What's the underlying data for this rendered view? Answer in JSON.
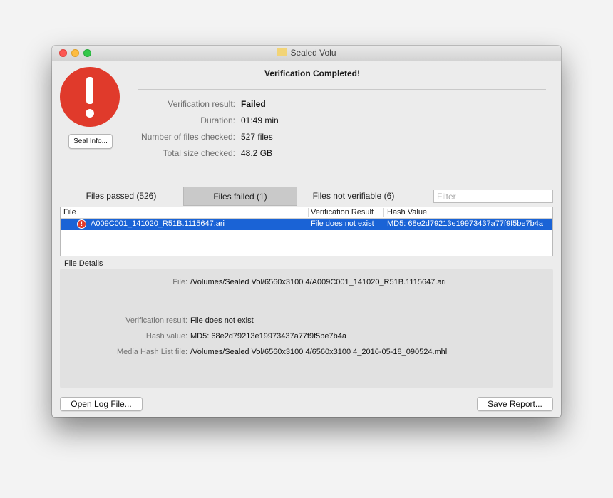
{
  "window": {
    "title": "Sealed Volu"
  },
  "dialog": {
    "heading": "Verification Completed!",
    "seal_info_button": "Seal Info...",
    "summary": [
      {
        "label": "Verification result:",
        "value": "Failed"
      },
      {
        "label": "Duration:",
        "value": "01:49 min"
      },
      {
        "label": "Number of files checked:",
        "value": "527 files"
      },
      {
        "label": "Total size checked:",
        "value": "48.2 GB"
      }
    ]
  },
  "tabs": [
    {
      "label": "Files passed (526)",
      "selected": false
    },
    {
      "label": "Files failed (1)",
      "selected": true
    },
    {
      "label": "Files not verifiable (6)",
      "selected": false
    }
  ],
  "filter": {
    "placeholder": "Filter",
    "value": ""
  },
  "table": {
    "columns": [
      "File",
      "Verification Result",
      "Hash Value"
    ],
    "rows": [
      {
        "file": "A009C001_141020_R51B.1115647.ari",
        "result": "File does not exist",
        "hash": "MD5: 68e2d79213e19973437a77f9f5be7b4a",
        "selected": true,
        "status_icon": "error-icon"
      }
    ]
  },
  "details": {
    "section_label": "File Details",
    "file_label": "File:",
    "file_value": "/Volumes/Sealed Vol/6560x3100 4/A009C001_141020_R51B.1115647.ari",
    "result_label": "Verification result:",
    "result_value": "File does not exist",
    "hash_label": "Hash value:",
    "hash_value": "MD5: 68e2d79213e19973437a77f9f5be7b4a",
    "mhl_label": "Media Hash List file:",
    "mhl_value": "/Volumes/Sealed Vol/6560x3100 4/6560x3100 4_2016-05-18_090524.mhl"
  },
  "footer": {
    "open_log_button": "Open Log File...",
    "save_report_button": "Save Report..."
  },
  "colors": {
    "selection": "#1a63d6",
    "alert": "#e03a2b",
    "tab_selected": "#c9c9c9"
  }
}
